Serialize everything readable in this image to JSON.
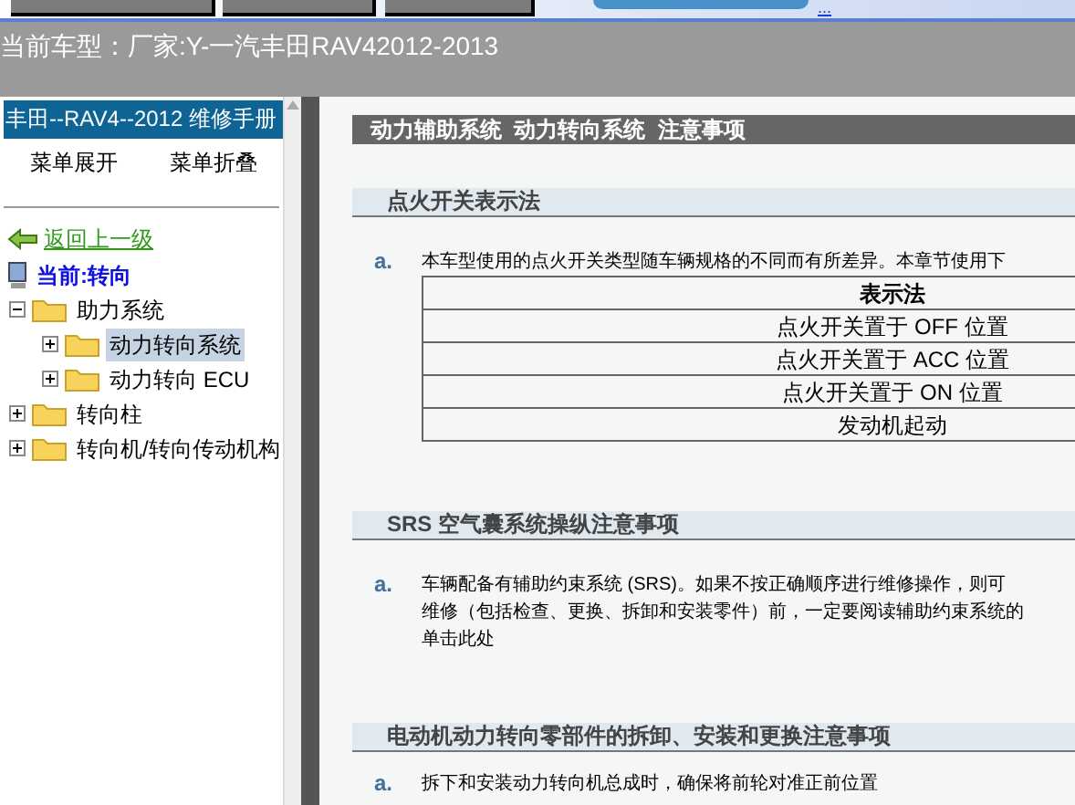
{
  "top_bar": {
    "link": "..."
  },
  "header": {
    "current_model": "当前车型：厂家:Y-一汽丰田RAV42012-2013"
  },
  "sidebar": {
    "title": "丰田--RAV4--2012 维修手册",
    "buttons": [
      "菜单展开",
      "菜单折叠"
    ],
    "back_link": "返回上一级",
    "current": "当前:转向",
    "tree": [
      {
        "label": "助力系统",
        "expanded": true,
        "selected": false,
        "children": [
          {
            "label": "动力转向系统",
            "expanded": false,
            "selected": true
          },
          {
            "label": "动力转向 ECU",
            "expanded": false,
            "selected": false
          }
        ]
      },
      {
        "label": "转向柱",
        "expanded": false,
        "selected": false
      },
      {
        "label": "转向机/转向传动机构",
        "expanded": false,
        "selected": false
      }
    ]
  },
  "content": {
    "breadcrumb": "动力辅助系统  动力转向系统  注意事项",
    "sections": [
      {
        "title": "点火开关表示法",
        "items": [
          {
            "marker": "a.",
            "lines": [
              "本车型使用的点火开关类型随车辆规格的不同而有所差异。本章节使用下"
            ],
            "table": {
              "header": "表示法",
              "rows": [
                "点火开关置于 OFF 位置",
                "点火开关置于 ACC 位置",
                "点火开关置于 ON 位置",
                "发动机起动"
              ]
            }
          }
        ]
      },
      {
        "title": "SRS 空气囊系统操纵注意事项",
        "items": [
          {
            "marker": "a.",
            "lines": [
              "车辆配备有辅助约束系统 (SRS)。如果不按正确顺序进行维修操作，则可",
              "维修（包括检查、更换、拆卸和安装零件）前，一定要阅读辅助约束系统的",
              "单击此处"
            ]
          }
        ]
      },
      {
        "title": "电动机动力转向零部件的拆卸、安装和更换注意事项",
        "items": [
          {
            "marker": "a.",
            "lines": [
              "拆下和安装动力转向机总成时，确保将前轮对准正前位置"
            ]
          }
        ]
      }
    ]
  }
}
